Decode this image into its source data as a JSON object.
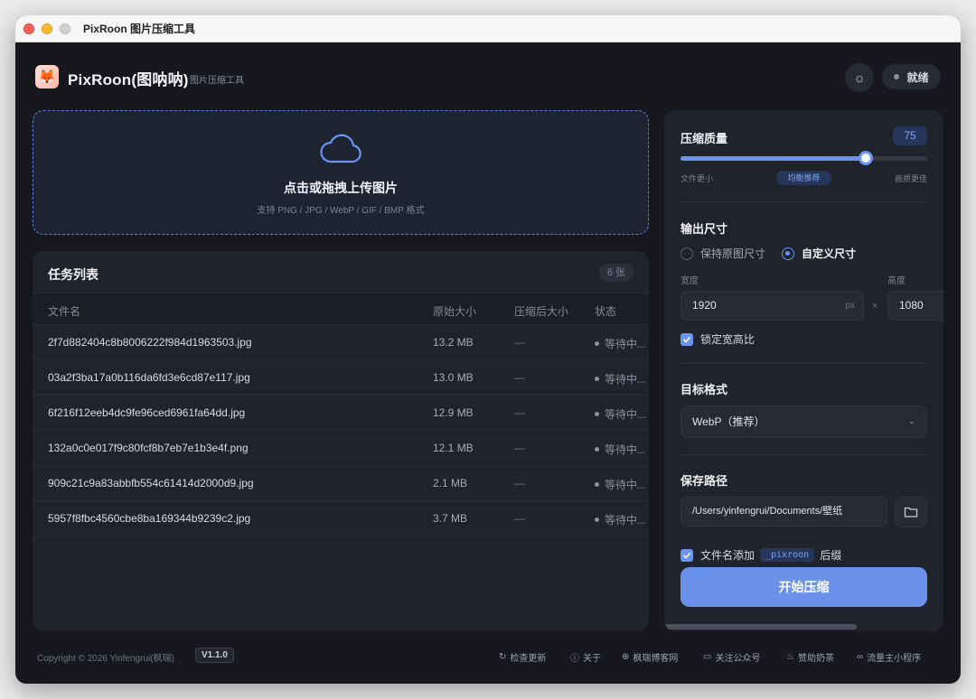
{
  "window": {
    "title": "PixRoon 图片压缩工具"
  },
  "header": {
    "app_name": "PixRoon(图呐呐)",
    "app_subtitle": "图片压缩工具",
    "status": "就绪"
  },
  "upload": {
    "title": "点击或拖拽上传图片",
    "hint": "支持 PNG / JPG / WebP / GIF / BMP 格式"
  },
  "tasks": {
    "title": "任务列表",
    "count": "6 张",
    "columns": {
      "name": "文件名",
      "original": "原始大小",
      "compressed": "压缩后大小",
      "status": "状态"
    },
    "rows": [
      {
        "name": "2f7d882404c8b8006222f984d1963503.jpg",
        "original": "13.2 MB",
        "compressed": "—",
        "status": "等待中..."
      },
      {
        "name": "03a2f3ba17a0b116da6fd3e6cd87e117.jpg",
        "original": "13.0 MB",
        "compressed": "—",
        "status": "等待中..."
      },
      {
        "name": "6f216f12eeb4dc9fe96ced6961fa64dd.jpg",
        "original": "12.9 MB",
        "compressed": "—",
        "status": "等待中..."
      },
      {
        "name": "132a0c0e017f9c80fcf8b7eb7e1b3e4f.png",
        "original": "12.1 MB",
        "compressed": "—",
        "status": "等待中..."
      },
      {
        "name": "909c21c9a83abbfb554c61414d2000d9.jpg",
        "original": "2.1 MB",
        "compressed": "—",
        "status": "等待中..."
      },
      {
        "name": "5957f8fbc4560cbe8ba169344b9239c2.jpg",
        "original": "3.7 MB",
        "compressed": "—",
        "status": "等待中..."
      }
    ]
  },
  "settings": {
    "quality": {
      "label": "压缩质量",
      "value": "75",
      "level": 0.75,
      "left_tag": "文件更小",
      "mid_tag": "均衡推荐",
      "right_tag": "画质更佳"
    },
    "size": {
      "label": "输出尺寸",
      "option_keep": "保持原图尺寸",
      "option_custom": "自定义尺寸",
      "selected": "custom",
      "width_label": "宽度",
      "height_label": "高度",
      "width_value": "1920",
      "height_value": "1080",
      "unit": "px",
      "times": "×",
      "lock_label": "锁定宽高比"
    },
    "format": {
      "label": "目标格式",
      "value": "WebP（推荐）"
    },
    "path": {
      "label": "保存路径",
      "value": "/Users/yinfengrui/Documents/壁纸",
      "suffix_prefix": "文件名添加",
      "suffix_code": "_pixroon",
      "suffix_after": "后缀"
    },
    "start_button": "开始压缩"
  },
  "footer": {
    "copyright": "Copyright © 2026 Yinfengrui(枫瑞)",
    "version": "V1.1.0",
    "links": [
      "检查更新",
      "关于",
      "枫瑞博客网",
      "关注公众号",
      "赞助奶茶",
      "流量主小程序"
    ]
  },
  "colors": {
    "accent": "#6b93f0",
    "background": "#16181d",
    "panel": "#1f232b"
  }
}
